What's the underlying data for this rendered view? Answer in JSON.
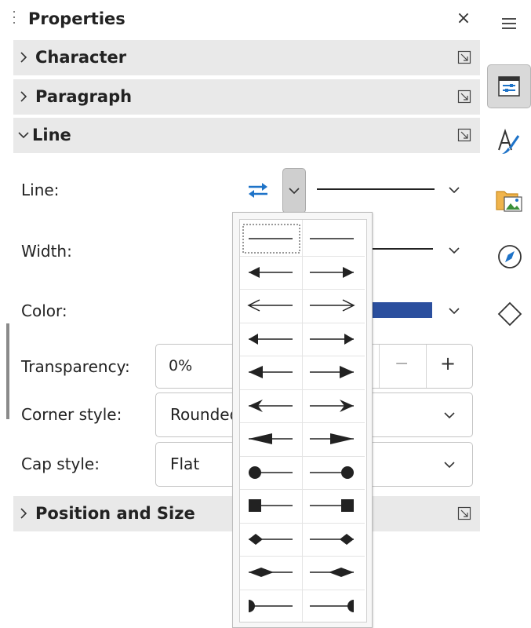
{
  "header": {
    "title": "Properties",
    "close_glyph": "×",
    "menu_icon": "hamburger-menu-icon"
  },
  "sections": {
    "character": {
      "label": "Character"
    },
    "paragraph": {
      "label": "Paragraph"
    },
    "line": {
      "label": "Line"
    },
    "position": {
      "label": "Position and Size"
    }
  },
  "line_panel": {
    "line_label": "Line:",
    "width_label": "Width:",
    "color_label": "Color:",
    "transparency_label": "Transparency:",
    "transparency_value": "0%",
    "spin_minus": "−",
    "spin_plus": "+",
    "corner_label": "Corner style:",
    "corner_value": "Rounded",
    "cap_label": "Cap style:",
    "cap_value": "Flat",
    "color_swatch": "#2b4f9e"
  },
  "colors": {
    "accent_blue": "#1e73c8",
    "section_bg": "#e9e9e9"
  },
  "arrow_styles": [
    [
      "none",
      "none"
    ],
    [
      "arrow-left",
      "arrow-right"
    ],
    [
      "open-arrow-left",
      "open-arrow-right"
    ],
    [
      "short-arrow-left",
      "short-arrow-right"
    ],
    [
      "triangle-left",
      "triangle-right"
    ],
    [
      "concave-left",
      "concave-right"
    ],
    [
      "long-triangle-left",
      "long-triangle-right"
    ],
    [
      "circle-left",
      "circle-right"
    ],
    [
      "square-left",
      "square-right"
    ],
    [
      "diamond-left",
      "diamond-right"
    ],
    [
      "wide-diamond-left",
      "wide-diamond-right"
    ],
    [
      "half-circle-left",
      "half-circle-right"
    ]
  ],
  "sidebar_icons": [
    "properties-icon",
    "styles-icon",
    "gallery-icon",
    "navigator-icon",
    "shapes-icon"
  ]
}
